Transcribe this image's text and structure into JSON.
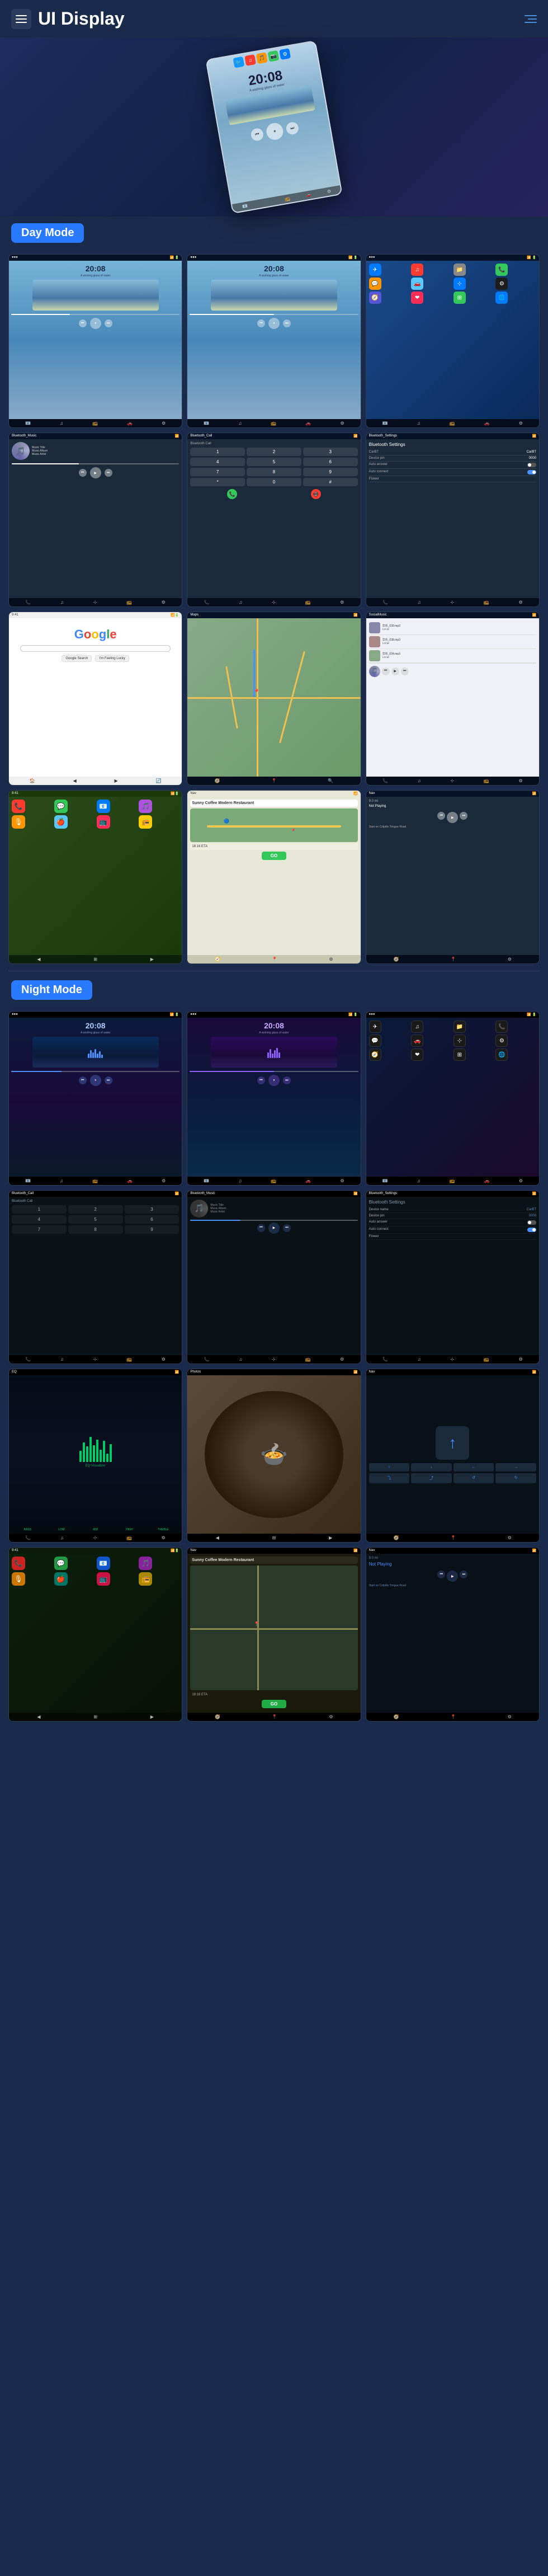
{
  "app": {
    "title": "UI Display",
    "nav_icon": "menu-icon",
    "nav_lines_icon": "nav-lines-icon"
  },
  "modes": {
    "day": "Day Mode",
    "night": "Night Mode"
  },
  "screens": {
    "music_time": "20:08",
    "music_subtitle": "A wishing glass of water",
    "music_title": "Music Title",
    "music_album": "Music Album",
    "music_artist": "Music Artist",
    "bt_music": "Bluetooth_Music",
    "bt_call": "Bluetooth_Call",
    "bt_settings": "Bluetooth_Settings",
    "google": "Google",
    "social_music": "SocialMusic",
    "device_name": "CarBT",
    "device_pin": "0000",
    "auto_answer": "Auto answer",
    "auto_connect": "Auto connect",
    "flower": "Flower",
    "coffee_restaurant": "Sunny Coffee Modern Restaurant",
    "eta": "18:16 ETA",
    "go_label": "GO",
    "not_playing": "Not Playing",
    "distance": "9.0 mi",
    "start_on": "Start on Colpitts Tongue Road",
    "night_mode_track1": "华乐_039.mp3",
    "night_mode_track2": "华乐_038.mp3",
    "night_mode_track3": "华乐_034.mp3"
  },
  "icons": {
    "menu": "☰",
    "nav_dots": "⋮",
    "play": "▶",
    "pause": "⏸",
    "prev": "⏮",
    "next": "⏭",
    "back": "◀",
    "fwd": "▶",
    "phone": "📞",
    "music": "♫",
    "nav": "🧭",
    "apps": "⊞",
    "bt": "⊹",
    "settings": "⚙",
    "search": "🔍",
    "car": "🚗",
    "location": "📍"
  },
  "colors": {
    "primary_bg": "#1a2a4a",
    "day_badge": "#2a7aff",
    "night_badge": "#2a7aff",
    "accent_blue": "#4a90ff",
    "screen_bg_day": "#4888b8",
    "screen_bg_night": "#0a1a3a"
  }
}
